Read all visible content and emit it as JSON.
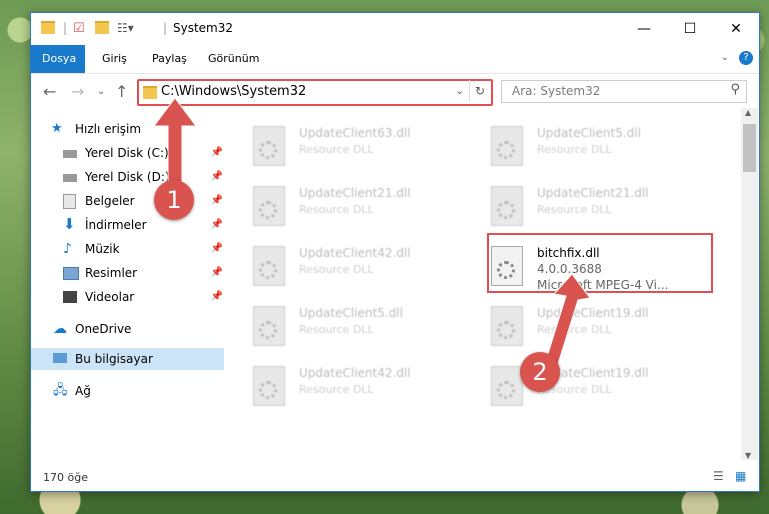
{
  "window_title": "System32",
  "ribbon_tabs": [
    "Dosya",
    "Giriş",
    "Paylaş",
    "Görünüm"
  ],
  "help_label": "?",
  "address": "C:\\Windows\\System32",
  "search_placeholder": "Ara: System32",
  "sidebar": {
    "quick_access": "Hızlı erişim",
    "items": [
      "Yerel Disk (C:)",
      "Yerel Disk (D:)",
      "Belgeler",
      "İndirmeler",
      "Müzik",
      "Resimler",
      "Videolar"
    ],
    "onedrive": "OneDrive",
    "this_pc": "Bu bilgisayar",
    "network": "Ağ"
  },
  "files_left": [
    {
      "name": "UpdateClient63.dll",
      "desc": "Resource DLL"
    },
    {
      "name": "UpdateClient21.dll",
      "desc": "Resource DLL"
    },
    {
      "name": "UpdateClient42.dll",
      "desc": "Resource DLL"
    },
    {
      "name": "UpdateClient5.dll",
      "desc": "Resource DLL"
    },
    {
      "name": "UpdateClient42.dll",
      "desc": "Resource DLL"
    }
  ],
  "files_right": [
    {
      "name": "UpdateClient5.dll",
      "desc": "Resource DLL"
    },
    {
      "name": "UpdateClient21.dll",
      "desc": "Resource DLL"
    },
    {
      "name": "bitchfix.dll",
      "desc": "4.0.0.3688",
      "desc2": "Microsoft MPEG-4 Vi..."
    },
    {
      "name": "UpdateClient19.dll",
      "desc": "Resource DLL"
    },
    {
      "name": "UpdateClient19.dll",
      "desc": "Resource DLL"
    }
  ],
  "status": "170 öğe",
  "badges": [
    "1",
    "2"
  ],
  "colors": {
    "accent": "#1979ca",
    "highlight": "#e05050",
    "selection": "#cce4f7"
  }
}
